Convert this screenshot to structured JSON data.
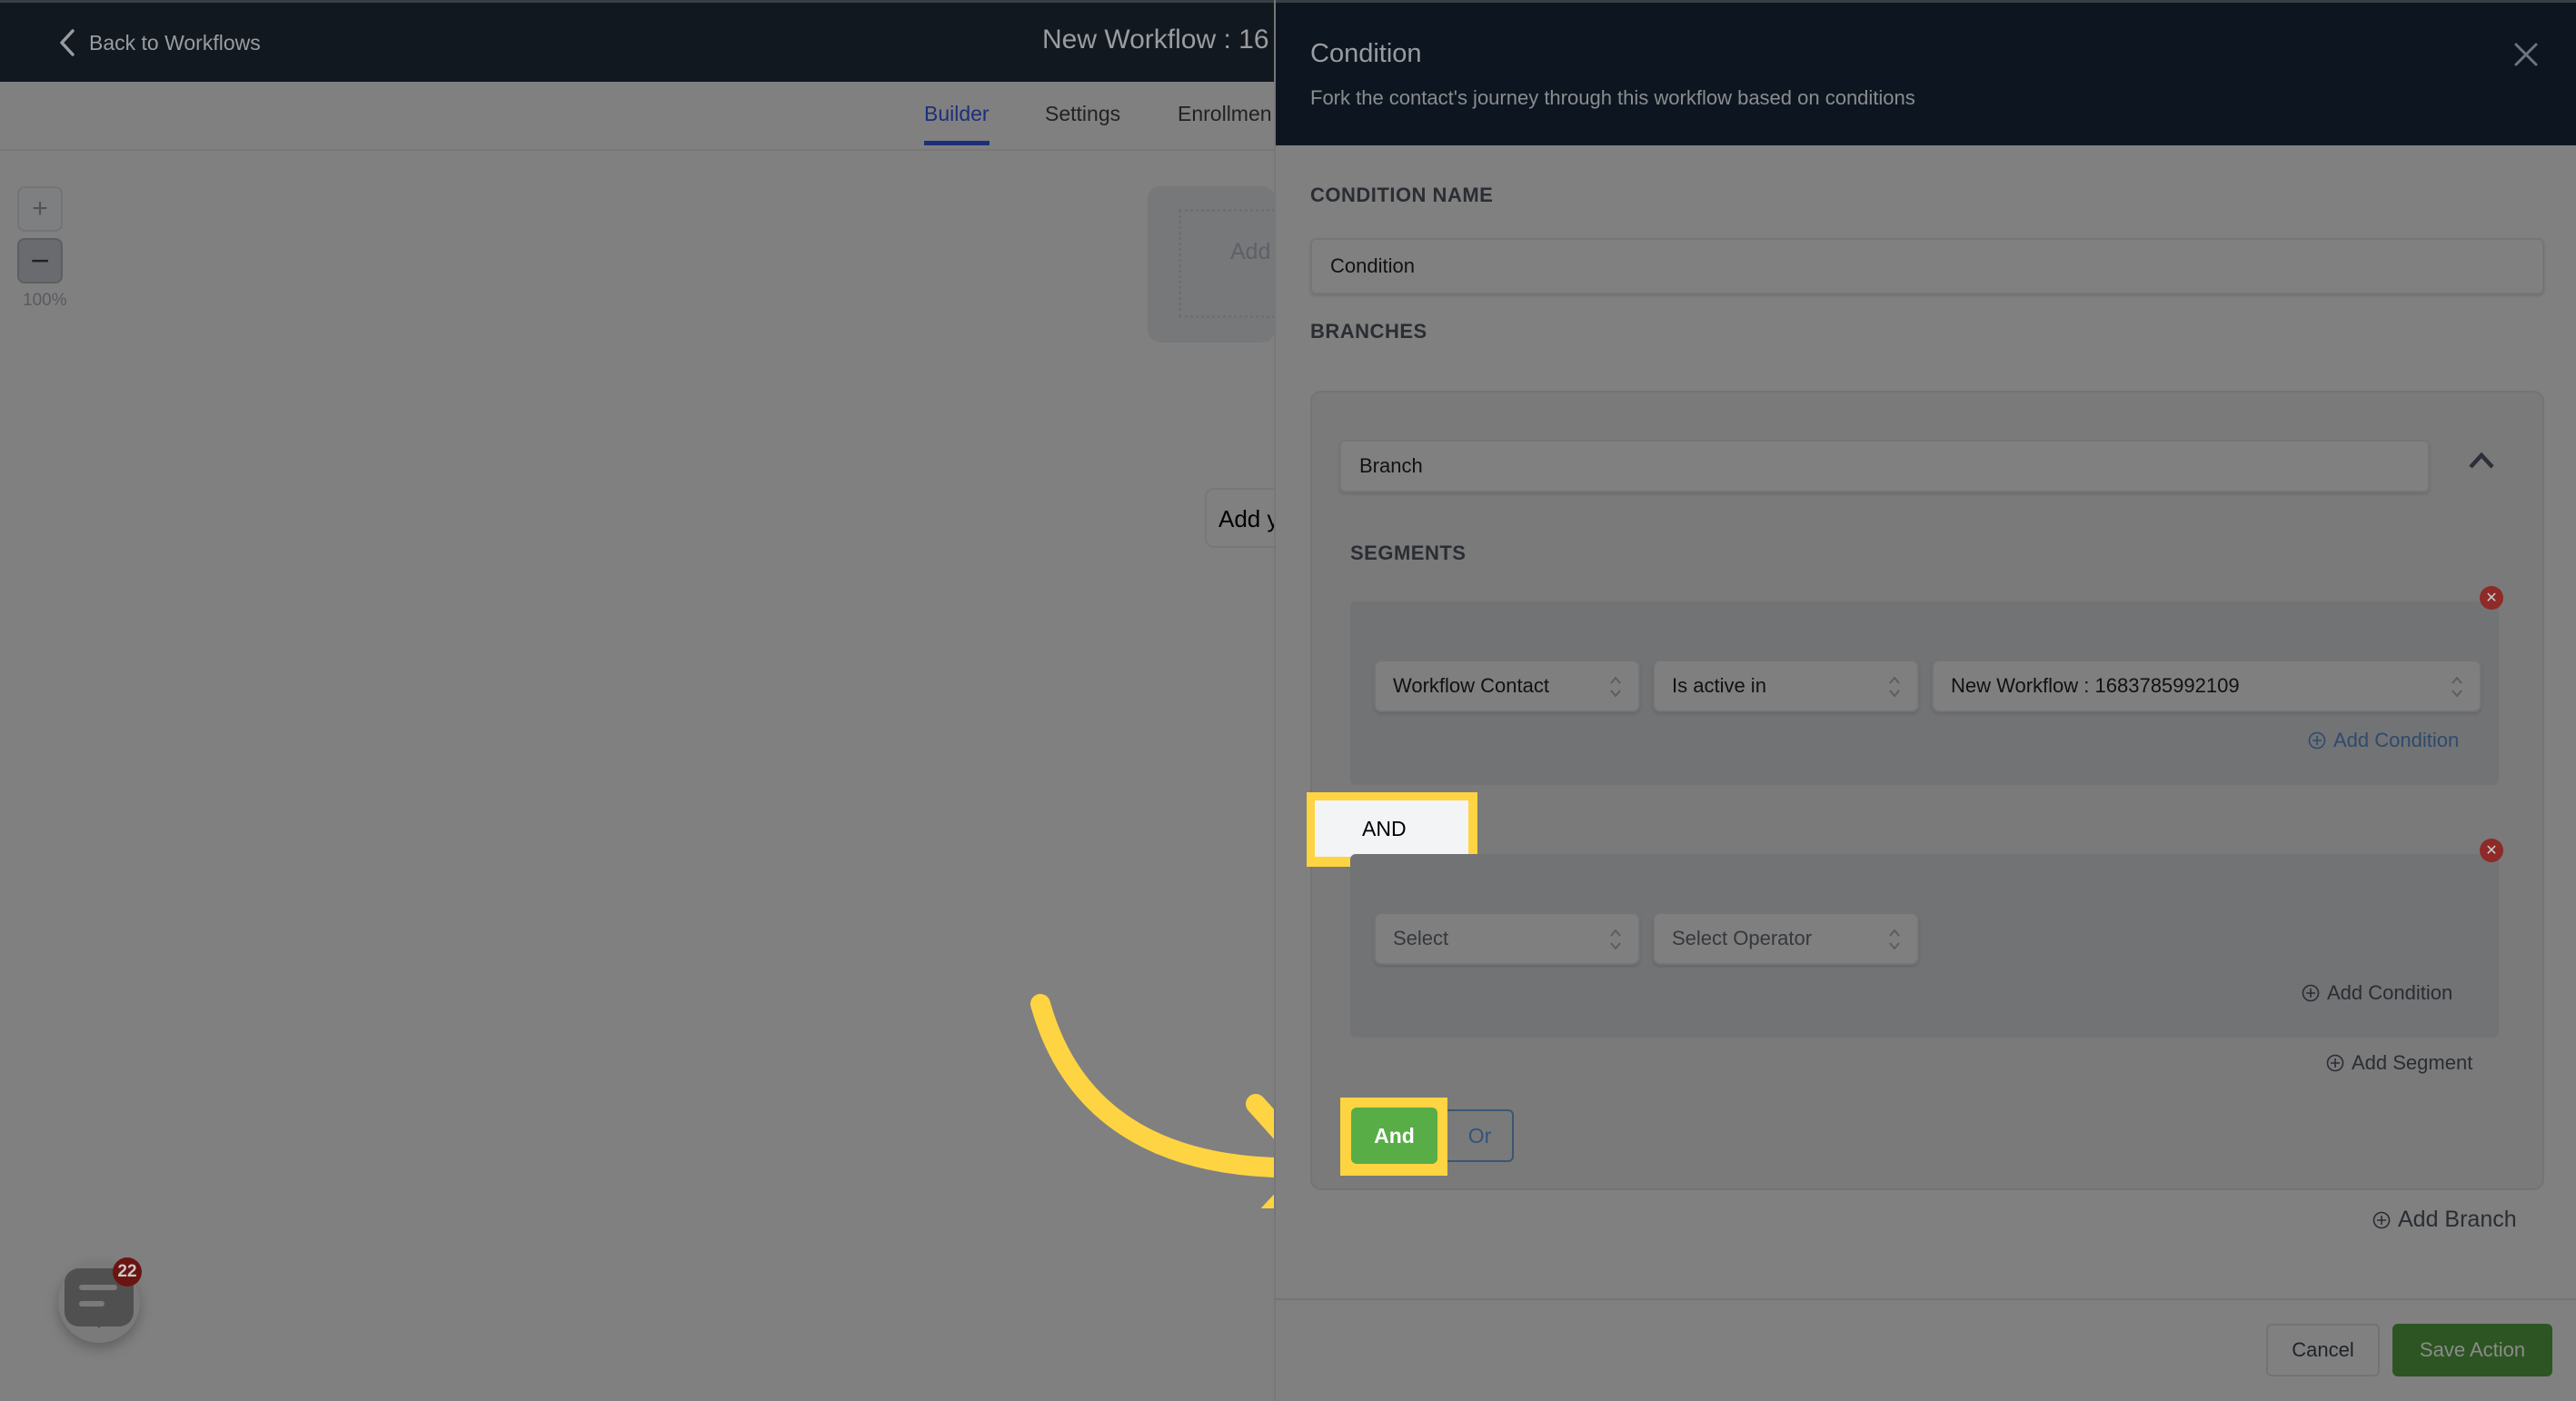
{
  "header": {
    "back_label": "Back to Workflows",
    "workflow_title": "New Workflow : 16"
  },
  "tabs": [
    {
      "label": "Builder",
      "active": true
    },
    {
      "label": "Settings",
      "active": false
    },
    {
      "label": "Enrollmen",
      "active": false
    }
  ],
  "canvas": {
    "zoom_in": "+",
    "zoom_out": "−",
    "zoom_level": "100%",
    "trigger_card_text": "Add",
    "add_action_text": "Add y"
  },
  "chat_widget": {
    "icon": "chat-bubble-icon",
    "badge_count": "22"
  },
  "drawer": {
    "title": "Condition",
    "subtitle": "Fork the contact's journey through this workflow based on conditions",
    "close_icon": "close-icon",
    "condition_name_label": "CONDITION NAME",
    "condition_name_value": "Condition",
    "branches_label": "BRANCHES",
    "branch": {
      "name": "Branch",
      "collapse_icon": "chevron-up-icon",
      "segments_label": "SEGMENTS",
      "segments": [
        {
          "conditions": [
            {
              "field": "Workflow Contact",
              "operator": "Is active in",
              "value": "New Workflow : 1683785992109"
            }
          ],
          "add_condition_label": "Add Condition"
        },
        {
          "connector": "AND",
          "conditions": [
            {
              "field_placeholder": "Select",
              "operator_placeholder": "Select Operator"
            }
          ],
          "add_condition_label": "Add Condition"
        }
      ],
      "add_segment_label": "Add Segment",
      "logic_options": [
        {
          "label": "And",
          "selected": true
        },
        {
          "label": "Or",
          "selected": false
        }
      ]
    },
    "add_branch_label": "Add Branch",
    "cancel_label": "Cancel",
    "save_label": "Save Action"
  },
  "colors": {
    "highlight": "#ffd442",
    "and_selected": "#58ad46",
    "save_button": "#2d5523",
    "delete_badge": "#8e2a28",
    "active_tab": "#1d2f7a",
    "link_blue": "#32537a"
  }
}
